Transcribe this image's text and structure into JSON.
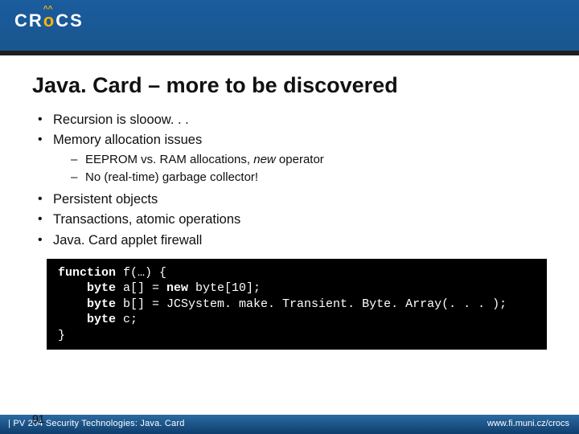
{
  "header": {
    "logo_left": "CR",
    "logo_mid": "CS",
    "logo_carets": "^^"
  },
  "title": "Java. Card – more to be discovered",
  "bullets": [
    {
      "text": "Recursion is slooow. . ."
    },
    {
      "text": "Memory allocation issues",
      "sub": [
        {
          "pre": "EEPROM vs. RAM allocations, ",
          "em": "new",
          "post": " operator"
        },
        {
          "pre": "No (real-time) garbage collector!",
          "em": "",
          "post": ""
        }
      ]
    },
    {
      "text": "Persistent objects"
    },
    {
      "text": "Transactions, atomic operations"
    },
    {
      "text": "Java. Card applet firewall"
    }
  ],
  "code": {
    "l1a": "function",
    "l1b": " f(…) {",
    "l2a": "    byte",
    "l2b": " a[] = ",
    "l2c": "new",
    "l2d": " byte[10];",
    "l3a": "    byte",
    "l3b": " b[] = JCSystem. make. Transient. Byte. Array(. . . );",
    "l4a": "    byte",
    "l4b": " c;",
    "l5": "}"
  },
  "page_number": "91",
  "footer": {
    "left": "| PV 204 Security Technologies: Java. Card",
    "right": "www.fi.muni.cz/crocs"
  }
}
